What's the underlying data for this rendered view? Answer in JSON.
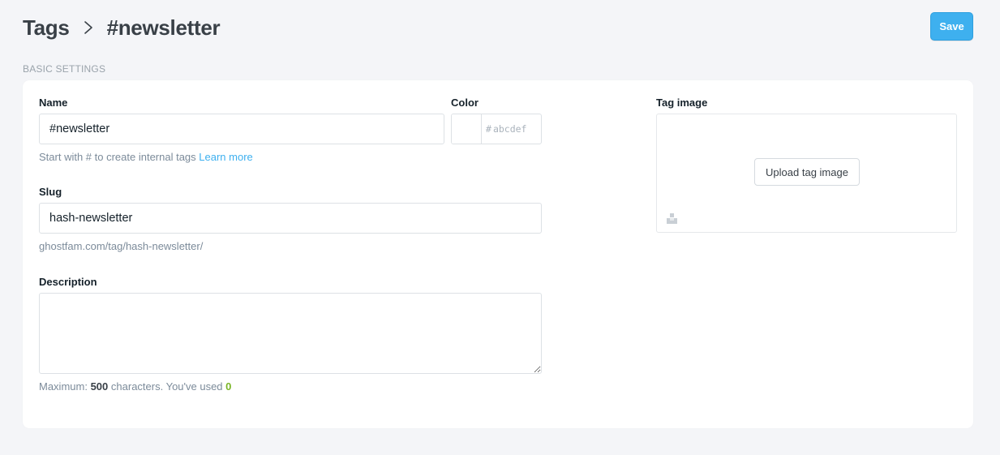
{
  "breadcrumb": {
    "parent": "Tags",
    "current": "#newsletter"
  },
  "toolbar": {
    "save_label": "Save"
  },
  "section": {
    "title": "BASIC SETTINGS"
  },
  "form": {
    "name": {
      "label": "Name",
      "value": "#newsletter",
      "hint": "Start with # to create internal tags",
      "hint_link": "Learn more"
    },
    "color": {
      "label": "Color",
      "hash": "#",
      "placeholder": "abcdef"
    },
    "slug": {
      "label": "Slug",
      "value": "hash-newsletter",
      "url_hint": "ghostfam.com/tag/hash-newsletter/"
    },
    "description": {
      "label": "Description",
      "value": "",
      "counter_prefix": "Maximum:",
      "max": "500",
      "counter_middle": "characters. You've used",
      "used": "0"
    },
    "tag_image": {
      "label": "Tag image",
      "upload_label": "Upload tag image"
    }
  },
  "colors": {
    "accent": "#3eb0ef",
    "background": "#f4f5f8",
    "counter_ok": "#7ab526"
  }
}
